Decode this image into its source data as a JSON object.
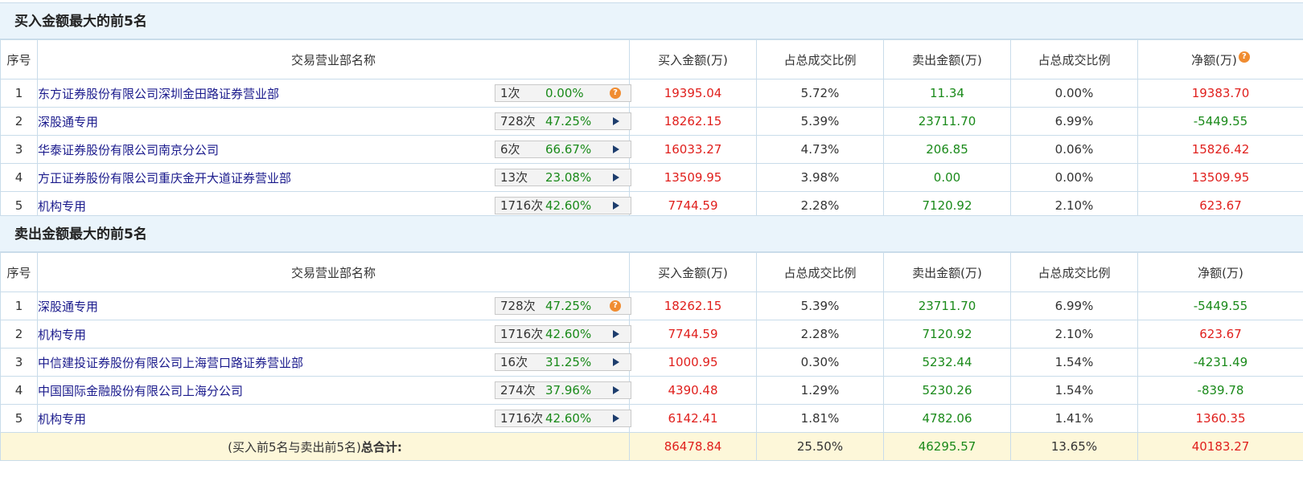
{
  "buy_section": {
    "title": "买入金额最大的前5名",
    "headers": [
      "序号",
      "交易营业部名称",
      "买入金额(万)",
      "占总成交比例",
      "卖出金额(万)",
      "占总成交比例",
      "净额(万)"
    ],
    "rows": [
      {
        "idx": "1",
        "name": "东方证券股份有限公司深圳金田路证券营业部",
        "count": "1次",
        "rate": "0.00%",
        "icon": "question-icon",
        "buy": "19395.04",
        "buy_ratio": "5.72%",
        "sell": "11.34",
        "sell_ratio": "0.00%",
        "net": "19383.70"
      },
      {
        "idx": "2",
        "name": "深股通专用",
        "count": "728次",
        "rate": "47.25%",
        "icon": "arrow-right-icon",
        "buy": "18262.15",
        "buy_ratio": "5.39%",
        "sell": "23711.70",
        "sell_ratio": "6.99%",
        "net": "-5449.55"
      },
      {
        "idx": "3",
        "name": "华泰证券股份有限公司南京分公司",
        "count": "6次",
        "rate": "66.67%",
        "icon": "arrow-right-icon",
        "buy": "16033.27",
        "buy_ratio": "4.73%",
        "sell": "206.85",
        "sell_ratio": "0.06%",
        "net": "15826.42"
      },
      {
        "idx": "4",
        "name": "方正证券股份有限公司重庆金开大道证券营业部",
        "count": "13次",
        "rate": "23.08%",
        "icon": "arrow-right-icon",
        "buy": "13509.95",
        "buy_ratio": "3.98%",
        "sell": "0.00",
        "sell_ratio": "0.00%",
        "net": "13509.95"
      },
      {
        "idx": "5",
        "name": "机构专用",
        "count": "1716次",
        "rate": "42.60%",
        "icon": "arrow-right-icon",
        "buy": "7744.59",
        "buy_ratio": "2.28%",
        "sell": "7120.92",
        "sell_ratio": "2.10%",
        "net": "623.67"
      }
    ]
  },
  "sell_section": {
    "title": "卖出金额最大的前5名",
    "headers": [
      "序号",
      "交易营业部名称",
      "买入金额(万)",
      "占总成交比例",
      "卖出金额(万)",
      "占总成交比例",
      "净额(万)"
    ],
    "rows": [
      {
        "idx": "1",
        "name": "深股通专用",
        "count": "728次",
        "rate": "47.25%",
        "icon": "question-icon",
        "buy": "18262.15",
        "buy_ratio": "5.39%",
        "sell": "23711.70",
        "sell_ratio": "6.99%",
        "net": "-5449.55"
      },
      {
        "idx": "2",
        "name": "机构专用",
        "count": "1716次",
        "rate": "42.60%",
        "icon": "arrow-right-icon",
        "buy": "7744.59",
        "buy_ratio": "2.28%",
        "sell": "7120.92",
        "sell_ratio": "2.10%",
        "net": "623.67"
      },
      {
        "idx": "3",
        "name": "中信建投证券股份有限公司上海营口路证券营业部",
        "count": "16次",
        "rate": "31.25%",
        "icon": "arrow-right-icon",
        "buy": "1000.95",
        "buy_ratio": "0.30%",
        "sell": "5232.44",
        "sell_ratio": "1.54%",
        "net": "-4231.49"
      },
      {
        "idx": "4",
        "name": "中国国际金融股份有限公司上海分公司",
        "count": "274次",
        "rate": "37.96%",
        "icon": "arrow-right-icon",
        "buy": "4390.48",
        "buy_ratio": "1.29%",
        "sell": "5230.26",
        "sell_ratio": "1.54%",
        "net": "-839.78"
      },
      {
        "idx": "5",
        "name": "机构专用",
        "count": "1716次",
        "rate": "42.60%",
        "icon": "arrow-right-icon",
        "buy": "6142.41",
        "buy_ratio": "1.81%",
        "sell": "4782.06",
        "sell_ratio": "1.41%",
        "net": "1360.35"
      }
    ]
  },
  "total": {
    "label_prefix": "(买入前5名与卖出前5名)",
    "label_bold": "总合计:",
    "buy": "86478.84",
    "buy_ratio": "25.50%",
    "sell": "46295.57",
    "sell_ratio": "13.65%",
    "net": "40183.27"
  },
  "colors": {
    "positive": "#e0201d",
    "negative": "#1a8a1a",
    "header_bg": "#eaf4fb",
    "total_bg": "#fdf7d9",
    "border": "#c9dcea"
  }
}
